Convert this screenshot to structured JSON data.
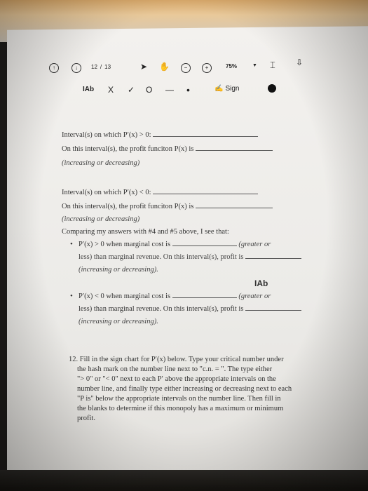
{
  "toolbar": {
    "page_current": "12",
    "page_sep": "/",
    "page_total": "13",
    "zoom": "75%"
  },
  "pen_bar": {
    "text_tool": "IAb",
    "x_tool": "X",
    "check_tool": "✓",
    "circle_tool": "O",
    "line_tool": "—",
    "dot_tool": "•",
    "sign_label": "Sign"
  },
  "doc": {
    "q1_line1": "Interval(s) on which P′(x) > 0:",
    "q1_line2": "On this interval(s), the profit funciton P(x) is",
    "q1_line3": "(increasing or decreasing)",
    "q2_line1": "Interval(s) on which P′(x) < 0:",
    "q2_line2": "On this interval(s), the profit funciton P(x) is",
    "q2_line3": "(increasing or decreasing)",
    "compare": "Comparing my answers with #4 and #5 above, I see that:",
    "b1_a": "P′(x) > 0 when marginal cost is",
    "b1_a2": "(greater or",
    "b1_b": "less) than marginal revenue. On this interval(s), profit is",
    "b1_c": "(increasing or decreasing).",
    "stamp": "IAb",
    "b2_a": "P′(x) < 0 when marginal cost is",
    "b2_a2": "(greater or",
    "b2_b": "less) than marginal revenue. On this interval(s), profit is",
    "b2_c": "(increasing or decreasing).",
    "q12_1": "12. Fill in the sign chart for P′(x) below. Type your critical number under",
    "q12_2": "the hash mark on the number line next to \"c.n. = \". The type either",
    "q12_3": "\"> 0\" or \"< 0\" next to each P′ above the appropriate intervals on the",
    "q12_4": "number line, and finally type either increasing or decreasing next to each",
    "q12_5": "\"P is\" below the appropriate intervals on the number line. Then fill in",
    "q12_6": "the blanks to determine if this monopoly has a maximum or minimum",
    "q12_7": "profit."
  }
}
